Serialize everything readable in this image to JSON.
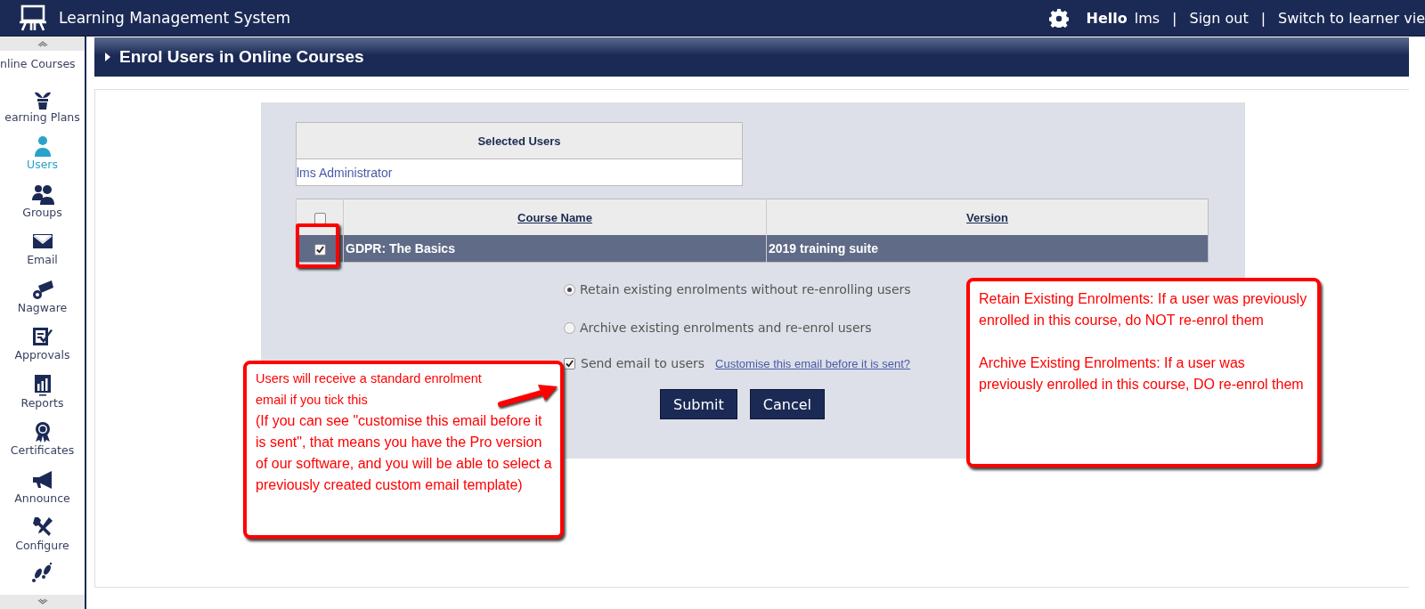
{
  "app_title": "Learning Management System",
  "header": {
    "greeting": "Hello",
    "items": [
      {
        "kind": "text",
        "text": "lms"
      },
      {
        "kind": "separator",
        "text": "|"
      },
      {
        "kind": "link",
        "text": "Sign out"
      },
      {
        "kind": "separator",
        "text": "|"
      },
      {
        "kind": "link",
        "text": "Switch to learner vie"
      }
    ]
  },
  "sidebar": {
    "items": [
      {
        "label": "nline Courses",
        "selected": false
      },
      {
        "label": "earning Plans",
        "selected": false
      },
      {
        "label": "Users",
        "selected": true
      },
      {
        "label": "Groups",
        "selected": false
      },
      {
        "label": "Email",
        "selected": false
      },
      {
        "label": "Nagware",
        "selected": false
      },
      {
        "label": "Approvals",
        "selected": false
      },
      {
        "label": "Reports",
        "selected": false
      },
      {
        "label": "Certificates",
        "selected": false
      },
      {
        "label": "Announce",
        "selected": false
      },
      {
        "label": "Configure",
        "selected": false
      }
    ]
  },
  "page": {
    "title": "Enrol Users in Online Courses"
  },
  "selected_users": {
    "heading": "Selected Users",
    "rows": [
      "lms Administrator"
    ]
  },
  "courses": {
    "all_checked": false,
    "columns": [
      "Course Name",
      "Version"
    ],
    "rows": [
      {
        "name": "GDPR: The Basics",
        "version": "2019 training suite",
        "checked": true,
        "selected": true
      }
    ]
  },
  "options": [
    {
      "label": "Retain existing enrolments without re-enrolling users",
      "selected": true
    },
    {
      "label": "Archive existing enrolments and re-enrol users",
      "selected": false
    }
  ],
  "send_email": {
    "label": "Send email to users",
    "checked": true,
    "link": "Customise this email before it is sent?"
  },
  "buttons": [
    "Submit",
    "Cancel"
  ],
  "callouts": [
    {
      "paragraphs": [
        "Users will receive a standard enrolment email if you tick this",
        "(If you can see \"customise this email before it is sent\", that means you have the Pro version of our software, and you will be able to select a previously created custom email template)"
      ]
    },
    {
      "paragraphs": [
        "Retain Existing Enrolments: If a user was previously enrolled in this course, do NOT re-enrol them",
        "Archive Existing Enrolments: If a user was previously enrolled in this course, DO re-enrol them"
      ]
    }
  ]
}
